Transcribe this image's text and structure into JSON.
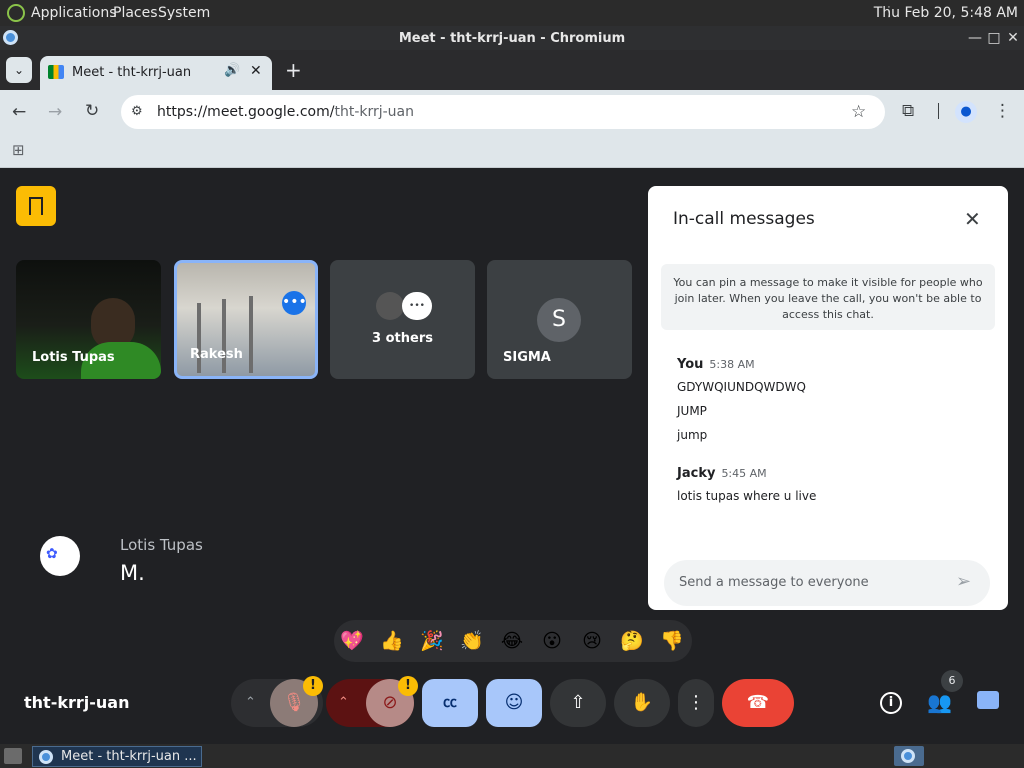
{
  "os": {
    "menu": [
      "Applications",
      "Places",
      "System"
    ],
    "clock": "Thu Feb 20,  5:48 AM"
  },
  "window": {
    "title": "Meet - tht-krrj-uan - Chromium"
  },
  "browser": {
    "tab_title": "Meet - tht-krrj-uan",
    "url_host": "https://meet.google.com/",
    "url_path": "tht-krrj-uan"
  },
  "meet": {
    "tiles": [
      {
        "name": "Lotis Tupas"
      },
      {
        "name": "Rakesh"
      },
      {
        "name": "3 others"
      },
      {
        "name": "SIGMA",
        "initial": "S"
      }
    ],
    "presenter": {
      "name": "Lotis Tupas",
      "caption": "M."
    },
    "meeting_code": "tht-krrj-uan",
    "participant_count": "6",
    "reactions": [
      "💖",
      "👍",
      "🎉",
      "👏",
      "😂",
      "😮",
      "😢",
      "🤔",
      "👎"
    ]
  },
  "chat": {
    "heading": "In-call messages",
    "notice": "You can pin a message to make it visible for people who join later. When you leave the call, you won't be able to access this chat.",
    "messages": [
      {
        "sender": "You",
        "time": "5:38 AM",
        "lines": [
          "GDYWQIUNDQWDWQ",
          "JUMP",
          "jump"
        ]
      },
      {
        "sender": "Jacky",
        "time": "5:45 AM",
        "lines": [
          "lotis tupas where u live"
        ]
      }
    ],
    "input_placeholder": "Send a message to everyone"
  },
  "taskbar": {
    "item": "Meet - tht-krrj-uan ..."
  },
  "colors": {
    "accent_blue": "#8ab4f8",
    "end_call": "#ea4335",
    "warning": "#fbbc04"
  }
}
